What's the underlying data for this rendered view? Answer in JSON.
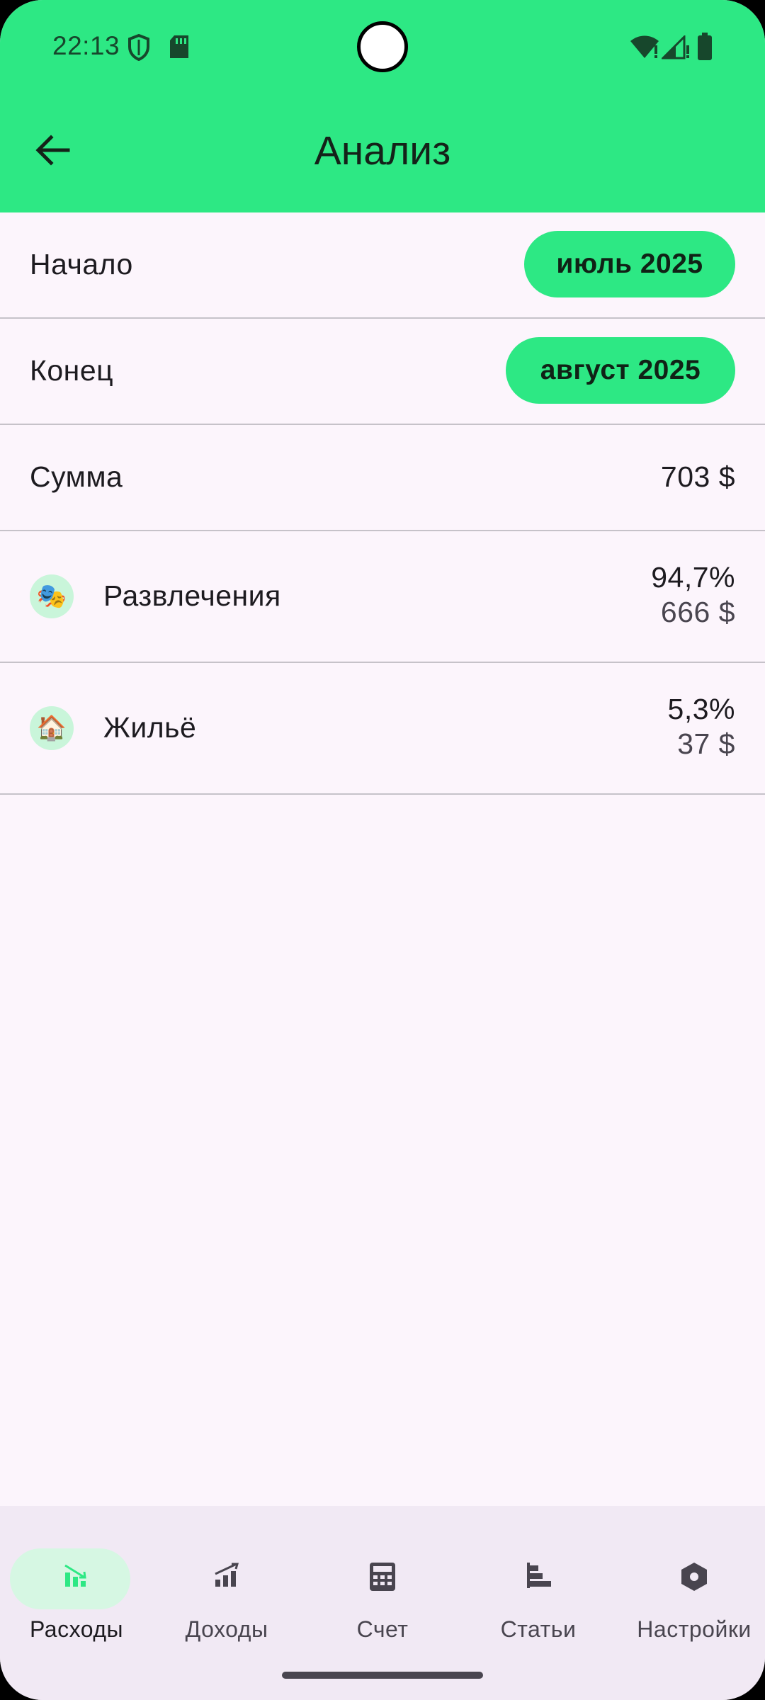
{
  "status_bar": {
    "time": "22:13"
  },
  "app_bar": {
    "title": "Анализ"
  },
  "period": {
    "start_label": "Начало",
    "start_value": "июль 2025",
    "end_label": "Конец",
    "end_value": "август 2025"
  },
  "summary": {
    "label": "Сумма",
    "value": "703 $"
  },
  "categories": [
    {
      "emoji": "🎭",
      "icon": "theater-masks-icon",
      "name": "Развлечения",
      "percent": "94,7%",
      "amount": "666 $"
    },
    {
      "emoji": "🏠",
      "icon": "house-icon",
      "name": "Жильё",
      "percent": "5,3%",
      "amount": "37 $"
    }
  ],
  "nav": [
    {
      "label": "Расходы",
      "icon": "expenses-chart-icon",
      "active": true
    },
    {
      "label": "Доходы",
      "icon": "income-chart-icon",
      "active": false
    },
    {
      "label": "Счет",
      "icon": "calculator-icon",
      "active": false
    },
    {
      "label": "Статьи",
      "icon": "articles-icon",
      "active": false
    },
    {
      "label": "Настройки",
      "icon": "settings-icon",
      "active": false
    }
  ],
  "colors": {
    "accent": "#2de884",
    "background": "#fcf5fc",
    "nav_background": "#f1e9f4",
    "active_indicator": "#d6f7e3"
  }
}
